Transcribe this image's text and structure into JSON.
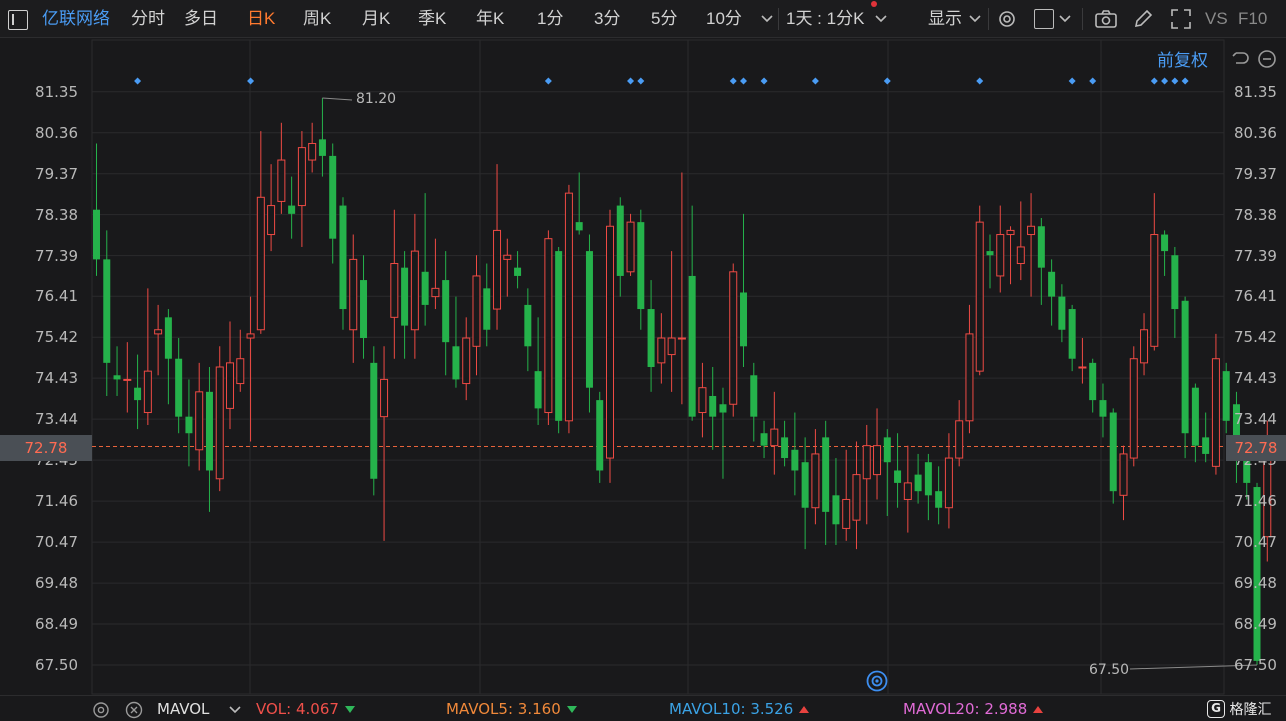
{
  "toolbar": {
    "stock_name": "亿联网络",
    "periods": [
      "分时",
      "多日",
      "日K",
      "周K",
      "月K",
      "季K",
      "年K",
      "1分",
      "3分",
      "5分",
      "10分"
    ],
    "active_period": "日K",
    "interval_select": "1天 : 1分K",
    "display_label": "显示",
    "vs_label": "VS",
    "f10_label": "F10"
  },
  "subbar": {
    "adjust_label": "前复权"
  },
  "chart_data": {
    "type": "candlestick",
    "ylim": [
      66.8,
      82.6
    ],
    "y_ticks": [
      "81.35",
      "80.36",
      "79.37",
      "78.38",
      "77.39",
      "76.41",
      "75.42",
      "74.43",
      "73.44",
      "72.45",
      "71.46",
      "70.47",
      "69.48",
      "68.49",
      "67.50"
    ],
    "current_price": "72.78",
    "high_label": "81.20",
    "low_label": "67.50",
    "candles": [
      {
        "o": 78.5,
        "c": 77.3,
        "h": 80.1,
        "l": 76.9
      },
      {
        "o": 77.3,
        "c": 74.8,
        "h": 78.0,
        "l": 74.0
      },
      {
        "o": 74.5,
        "c": 74.4,
        "h": 75.2,
        "l": 74.0
      },
      {
        "o": 74.4,
        "c": 74.4,
        "h": 75.3,
        "l": 73.6
      },
      {
        "o": 74.2,
        "c": 73.9,
        "h": 75.0,
        "l": 73.2
      },
      {
        "o": 73.6,
        "c": 74.6,
        "h": 76.6,
        "l": 73.3
      },
      {
        "o": 75.5,
        "c": 75.6,
        "h": 76.2,
        "l": 74.5
      },
      {
        "o": 75.9,
        "c": 74.9,
        "h": 76.1,
        "l": 73.8
      },
      {
        "o": 74.9,
        "c": 73.5,
        "h": 75.4,
        "l": 73.1
      },
      {
        "o": 73.5,
        "c": 73.1,
        "h": 74.4,
        "l": 72.3
      },
      {
        "o": 72.7,
        "c": 74.1,
        "h": 74.8,
        "l": 72.2
      },
      {
        "o": 74.1,
        "c": 72.2,
        "h": 74.7,
        "l": 71.2
      },
      {
        "o": 72.0,
        "c": 74.7,
        "h": 75.2,
        "l": 71.7
      },
      {
        "o": 73.7,
        "c": 74.8,
        "h": 75.8,
        "l": 73.2
      },
      {
        "o": 74.3,
        "c": 74.9,
        "h": 75.6,
        "l": 74.1
      },
      {
        "o": 75.4,
        "c": 75.5,
        "h": 76.4,
        "l": 72.9
      },
      {
        "o": 75.6,
        "c": 78.8,
        "h": 80.4,
        "l": 75.5
      },
      {
        "o": 77.9,
        "c": 78.6,
        "h": 79.6,
        "l": 77.5
      },
      {
        "o": 78.7,
        "c": 79.7,
        "h": 80.6,
        "l": 78.4
      },
      {
        "o": 78.6,
        "c": 78.4,
        "h": 79.3,
        "l": 77.8
      },
      {
        "o": 78.6,
        "c": 80.0,
        "h": 80.4,
        "l": 77.6
      },
      {
        "o": 79.7,
        "c": 80.1,
        "h": 80.6,
        "l": 79.4
      },
      {
        "o": 80.2,
        "c": 79.8,
        "h": 81.2,
        "l": 79.3
      },
      {
        "o": 79.8,
        "c": 77.8,
        "h": 80.1,
        "l": 77.2
      },
      {
        "o": 78.6,
        "c": 76.1,
        "h": 78.8,
        "l": 75.6
      },
      {
        "o": 75.6,
        "c": 77.3,
        "h": 77.9,
        "l": 74.8
      },
      {
        "o": 76.8,
        "c": 75.4,
        "h": 77.4,
        "l": 74.9
      },
      {
        "o": 74.8,
        "c": 72.0,
        "h": 75.2,
        "l": 71.6
      },
      {
        "o": 73.5,
        "c": 74.4,
        "h": 75.2,
        "l": 70.5
      },
      {
        "o": 75.9,
        "c": 77.2,
        "h": 78.5,
        "l": 74.9
      },
      {
        "o": 77.1,
        "c": 75.7,
        "h": 77.5,
        "l": 74.9
      },
      {
        "o": 75.6,
        "c": 77.5,
        "h": 78.4,
        "l": 74.9
      },
      {
        "o": 77.0,
        "c": 76.2,
        "h": 78.9,
        "l": 75.7
      },
      {
        "o": 76.4,
        "c": 76.6,
        "h": 77.8,
        "l": 76.1
      },
      {
        "o": 76.8,
        "c": 75.3,
        "h": 77.5,
        "l": 74.5
      },
      {
        "o": 75.2,
        "c": 74.4,
        "h": 76.4,
        "l": 74.2
      },
      {
        "o": 74.3,
        "c": 75.4,
        "h": 75.9,
        "l": 73.9
      },
      {
        "o": 75.2,
        "c": 76.9,
        "h": 77.4,
        "l": 74.5
      },
      {
        "o": 76.6,
        "c": 75.6,
        "h": 77.2,
        "l": 75.2
      },
      {
        "o": 76.1,
        "c": 78.0,
        "h": 79.6,
        "l": 75.6
      },
      {
        "o": 77.3,
        "c": 77.4,
        "h": 77.8,
        "l": 76.4
      },
      {
        "o": 77.1,
        "c": 76.9,
        "h": 77.5,
        "l": 76.6
      },
      {
        "o": 76.2,
        "c": 75.2,
        "h": 76.6,
        "l": 74.6
      },
      {
        "o": 74.6,
        "c": 73.7,
        "h": 75.9,
        "l": 73.3
      },
      {
        "o": 73.6,
        "c": 77.8,
        "h": 78.0,
        "l": 73.3
      },
      {
        "o": 77.5,
        "c": 73.4,
        "h": 77.6,
        "l": 73.1
      },
      {
        "o": 73.4,
        "c": 78.9,
        "h": 79.1,
        "l": 73.1
      },
      {
        "o": 78.2,
        "c": 78.0,
        "h": 79.4,
        "l": 77.9
      },
      {
        "o": 77.5,
        "c": 74.2,
        "h": 77.9,
        "l": 73.6
      },
      {
        "o": 73.9,
        "c": 72.2,
        "h": 74.1,
        "l": 71.9
      },
      {
        "o": 72.5,
        "c": 78.1,
        "h": 78.5,
        "l": 71.9
      },
      {
        "o": 78.6,
        "c": 76.9,
        "h": 78.8,
        "l": 76.4
      },
      {
        "o": 77.0,
        "c": 78.2,
        "h": 78.4,
        "l": 76.9
      },
      {
        "o": 78.2,
        "c": 76.1,
        "h": 78.5,
        "l": 75.6
      },
      {
        "o": 76.1,
        "c": 74.7,
        "h": 76.8,
        "l": 74.1
      },
      {
        "o": 74.8,
        "c": 75.4,
        "h": 76.0,
        "l": 74.3
      },
      {
        "o": 75.0,
        "c": 75.4,
        "h": 77.5,
        "l": 74.1
      },
      {
        "o": 75.4,
        "c": 75.4,
        "h": 79.4,
        "l": 73.8
      },
      {
        "o": 76.9,
        "c": 73.5,
        "h": 78.6,
        "l": 73.4
      },
      {
        "o": 73.6,
        "c": 74.2,
        "h": 74.8,
        "l": 73.0
      },
      {
        "o": 74.0,
        "c": 73.5,
        "h": 74.7,
        "l": 72.7
      },
      {
        "o": 73.8,
        "c": 73.6,
        "h": 74.2,
        "l": 72.0
      },
      {
        "o": 73.8,
        "c": 77.0,
        "h": 77.2,
        "l": 73.5
      },
      {
        "o": 76.5,
        "c": 75.2,
        "h": 78.4,
        "l": 74.7
      },
      {
        "o": 74.5,
        "c": 73.5,
        "h": 74.8,
        "l": 72.9
      },
      {
        "o": 73.1,
        "c": 72.8,
        "h": 73.4,
        "l": 72.5
      },
      {
        "o": 72.8,
        "c": 73.2,
        "h": 74.1,
        "l": 72.1
      },
      {
        "o": 73.0,
        "c": 72.5,
        "h": 73.4,
        "l": 72.3
      },
      {
        "o": 72.7,
        "c": 72.2,
        "h": 73.6,
        "l": 71.6
      },
      {
        "o": 72.4,
        "c": 71.3,
        "h": 73.0,
        "l": 70.3
      },
      {
        "o": 71.3,
        "c": 72.6,
        "h": 73.2,
        "l": 70.9
      },
      {
        "o": 73.0,
        "c": 71.2,
        "h": 73.4,
        "l": 70.4
      },
      {
        "o": 71.6,
        "c": 70.9,
        "h": 72.5,
        "l": 70.4
      },
      {
        "o": 70.8,
        "c": 71.5,
        "h": 72.7,
        "l": 70.5
      },
      {
        "o": 71.0,
        "c": 72.1,
        "h": 72.9,
        "l": 70.3
      },
      {
        "o": 72.0,
        "c": 72.8,
        "h": 73.3,
        "l": 70.9
      },
      {
        "o": 72.1,
        "c": 72.8,
        "h": 73.7,
        "l": 71.5
      },
      {
        "o": 73.0,
        "c": 72.4,
        "h": 73.2,
        "l": 71.1
      },
      {
        "o": 72.2,
        "c": 71.9,
        "h": 73.1,
        "l": 71.3
      },
      {
        "o": 71.5,
        "c": 71.9,
        "h": 72.8,
        "l": 70.7
      },
      {
        "o": 72.1,
        "c": 71.7,
        "h": 72.6,
        "l": 71.4
      },
      {
        "o": 72.4,
        "c": 71.6,
        "h": 72.6,
        "l": 71.0
      },
      {
        "o": 71.7,
        "c": 71.3,
        "h": 72.3,
        "l": 70.9
      },
      {
        "o": 71.3,
        "c": 72.5,
        "h": 73.1,
        "l": 70.8
      },
      {
        "o": 72.5,
        "c": 73.4,
        "h": 73.9,
        "l": 72.3
      },
      {
        "o": 73.4,
        "c": 75.5,
        "h": 76.2,
        "l": 73.1
      },
      {
        "o": 74.6,
        "c": 78.2,
        "h": 78.6,
        "l": 74.5
      },
      {
        "o": 77.5,
        "c": 77.4,
        "h": 77.9,
        "l": 76.6
      },
      {
        "o": 76.9,
        "c": 77.9,
        "h": 78.6,
        "l": 76.5
      },
      {
        "o": 77.9,
        "c": 78.0,
        "h": 78.1,
        "l": 76.7
      },
      {
        "o": 77.2,
        "c": 77.6,
        "h": 78.7,
        "l": 76.8
      },
      {
        "o": 77.9,
        "c": 78.1,
        "h": 78.9,
        "l": 76.4
      },
      {
        "o": 78.1,
        "c": 77.1,
        "h": 78.3,
        "l": 76.2
      },
      {
        "o": 77.0,
        "c": 76.4,
        "h": 77.3,
        "l": 75.7
      },
      {
        "o": 76.4,
        "c": 75.6,
        "h": 76.7,
        "l": 75.3
      },
      {
        "o": 76.1,
        "c": 74.9,
        "h": 76.2,
        "l": 74.6
      },
      {
        "o": 74.7,
        "c": 74.7,
        "h": 75.4,
        "l": 74.3
      },
      {
        "o": 74.8,
        "c": 73.9,
        "h": 74.9,
        "l": 73.6
      },
      {
        "o": 73.9,
        "c": 73.5,
        "h": 74.3,
        "l": 73.0
      },
      {
        "o": 73.6,
        "c": 71.7,
        "h": 73.7,
        "l": 71.4
      },
      {
        "o": 71.6,
        "c": 72.6,
        "h": 72.8,
        "l": 71.0
      },
      {
        "o": 72.5,
        "c": 74.9,
        "h": 75.2,
        "l": 72.3
      },
      {
        "o": 74.8,
        "c": 75.6,
        "h": 76.0,
        "l": 74.5
      },
      {
        "o": 75.2,
        "c": 77.9,
        "h": 78.9,
        "l": 75.1
      },
      {
        "o": 77.9,
        "c": 77.5,
        "h": 78.0,
        "l": 76.9
      },
      {
        "o": 77.4,
        "c": 76.1,
        "h": 77.6,
        "l": 75.4
      },
      {
        "o": 76.3,
        "c": 73.1,
        "h": 76.4,
        "l": 72.5
      },
      {
        "o": 74.2,
        "c": 72.8,
        "h": 74.3,
        "l": 72.4
      },
      {
        "o": 73.0,
        "c": 72.6,
        "h": 73.6,
        "l": 72.4
      },
      {
        "o": 72.3,
        "c": 74.9,
        "h": 75.5,
        "l": 72.1
      },
      {
        "o": 74.6,
        "c": 73.4,
        "h": 74.8,
        "l": 73.1
      },
      {
        "o": 73.8,
        "c": 72.5,
        "h": 74.1,
        "l": 71.9
      },
      {
        "o": 72.5,
        "c": 71.9,
        "h": 72.9,
        "l": 71.5
      },
      {
        "o": 71.8,
        "c": 67.6,
        "h": 71.9,
        "l": 67.5
      },
      {
        "o": 70.6,
        "c": 72.9,
        "h": 73.4,
        "l": 70.0
      }
    ],
    "up_color": "#ee4a44",
    "down_color": "#25b24b",
    "marker_color": "#4a9cf4"
  },
  "indicator_bar": {
    "name": "MAVOL",
    "vol_label": "VOL:",
    "vol_value": "4.067",
    "mavol5_label": "MAVOL5:",
    "mavol5_value": "3.160",
    "mavol10_label": "MAVOL10:",
    "mavol10_value": "3.526",
    "mavol20_label": "MAVOL20:",
    "mavol20_value": "2.988",
    "vol_color": "#f0504a",
    "mavol5_color": "#f0893a",
    "mavol10_color": "#3ba3e6",
    "mavol20_color": "#e06bd6"
  },
  "watermark": "格隆汇"
}
